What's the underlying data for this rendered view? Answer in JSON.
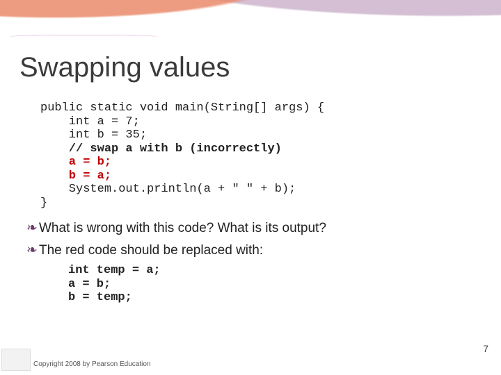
{
  "title": "Swapping values",
  "code": {
    "l0": "public static void main(String[] args) {",
    "l1": "    int a = 7;",
    "l2": "    int b = 35;",
    "l3": "",
    "l4": "    // swap a with b (incorrectly)",
    "l5": "    a = b;",
    "l6": "    b = a;",
    "l7": "",
    "l8": "    System.out.println(a + \" \" + b);",
    "l9": "}"
  },
  "bullets": {
    "glyph": "❧",
    "items": [
      "What is wrong with this code?  What is its output?",
      "The red code should be replaced with:"
    ]
  },
  "fix": {
    "l0": "int temp = a;",
    "l1": "a = b;",
    "l2": "b = temp;"
  },
  "page_number": "7",
  "copyright": "Copyright 2008 by Pearson Education"
}
